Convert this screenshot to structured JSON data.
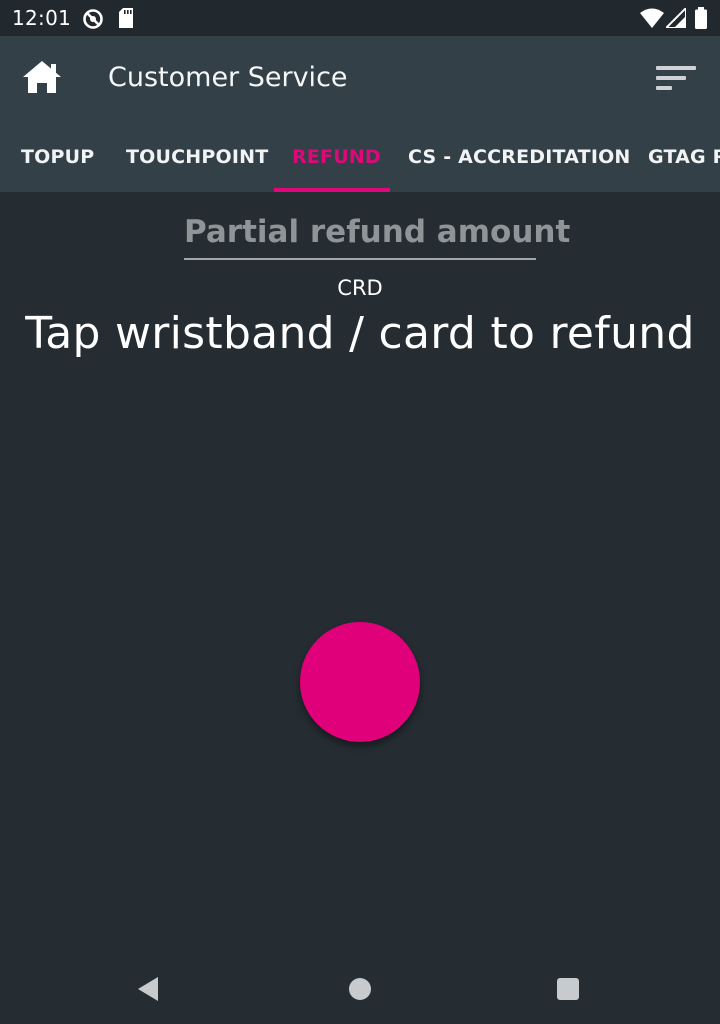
{
  "status_bar": {
    "time": "12:01",
    "icons": [
      "do-not-disturb-icon",
      "sd-card-icon",
      "wifi-icon",
      "cell-signal-icon",
      "battery-icon"
    ]
  },
  "app_bar": {
    "title": "Customer Service",
    "home_icon": "home-icon",
    "menu_icon": "filter-sort-icon"
  },
  "tabs": [
    {
      "label": "TOPUP",
      "active": false
    },
    {
      "label": "TOUCHPOINT",
      "active": false
    },
    {
      "label": "REFUND",
      "active": true
    },
    {
      "label": "CS - ACCREDITATION",
      "active": false
    },
    {
      "label": "GTAG R",
      "active": false
    }
  ],
  "refund": {
    "amount_placeholder": "Partial refund amount",
    "currency": "CRD",
    "instruction": "Tap wristband / card to refund"
  },
  "colors": {
    "accent": "#e0077a",
    "background": "#252d33",
    "app_bar": "#334048"
  },
  "nav_bar": {
    "icons": [
      "back-icon",
      "home-circle-icon",
      "recents-icon"
    ]
  }
}
